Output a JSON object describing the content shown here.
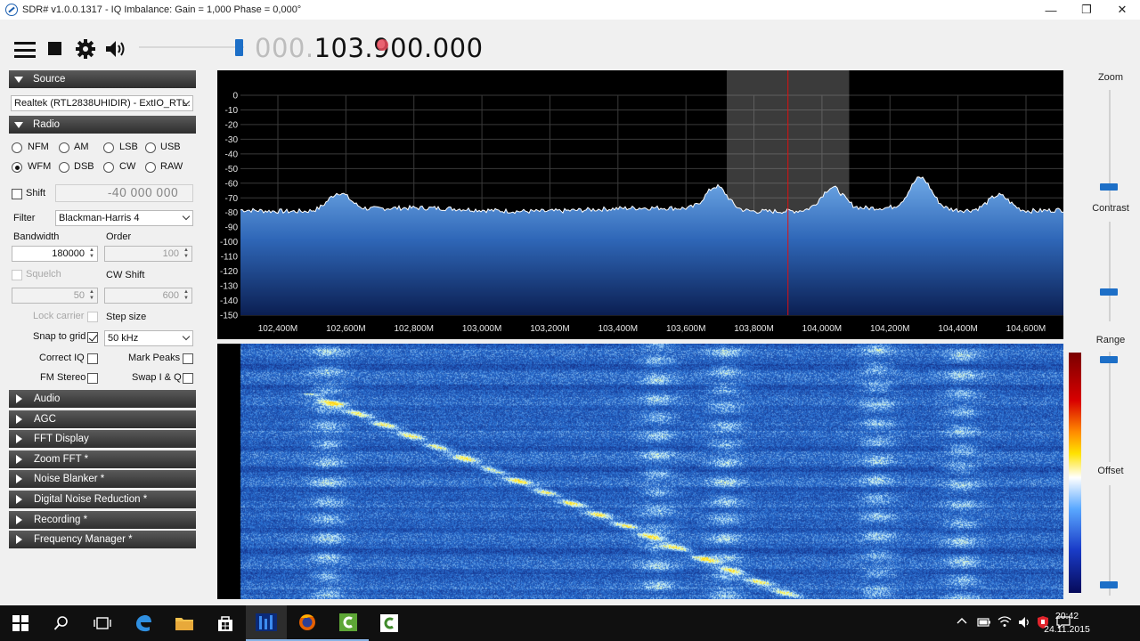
{
  "window": {
    "title": "SDR# v1.0.0.1317 - IQ Imbalance: Gain = 1,000 Phase = 0,000°",
    "minimize": "—",
    "maximize": "❐",
    "close": "✕"
  },
  "toolbar": {
    "frequency_dim": "000.",
    "frequency_lit": "103.900.000",
    "volume": 0.92
  },
  "source": {
    "header": "Source",
    "device": "Realtek (RTL2838UHIDIR) - ExtIO_RTL."
  },
  "radio": {
    "header": "Radio",
    "modes": [
      {
        "label": "NFM",
        "selected": false
      },
      {
        "label": "AM",
        "selected": false
      },
      {
        "label": "LSB",
        "selected": false
      },
      {
        "label": "USB",
        "selected": false
      },
      {
        "label": "WFM",
        "selected": true
      },
      {
        "label": "DSB",
        "selected": false
      },
      {
        "label": "CW",
        "selected": false
      },
      {
        "label": "RAW",
        "selected": false
      }
    ],
    "shift_label": "Shift",
    "shift_value": "-40 000 000",
    "filter_label": "Filter",
    "filter_value": "Blackman-Harris 4",
    "bandwidth_label": "Bandwidth",
    "bandwidth_value": "180000",
    "order_label": "Order",
    "order_value": "100",
    "squelch_label": "Squelch",
    "squelch_value": "50",
    "cwshift_label": "CW Shift",
    "cwshift_value": "600",
    "lock_carrier_label": "Lock carrier",
    "step_size_label": "Step size",
    "snap_label": "Snap to grid",
    "snap_value": "50 kHz",
    "correct_iq_label": "Correct IQ",
    "mark_peaks_label": "Mark Peaks",
    "fm_stereo_label": "FM Stereo",
    "swap_iq_label": "Swap I & Q"
  },
  "sections": [
    "Audio",
    "AGC",
    "FFT Display",
    "Zoom FFT *",
    "Noise Blanker *",
    "Digital Noise Reduction *",
    "Recording *",
    "Frequency Manager *"
  ],
  "spectrum": {
    "y_ticks": [
      "0",
      "-10",
      "-20",
      "-30",
      "-40",
      "-50",
      "-60",
      "-70",
      "-80",
      "-90",
      "-100",
      "-110",
      "-120",
      "-130",
      "-140",
      "-150"
    ],
    "x_ticks": [
      "102,400M",
      "102,600M",
      "102,800M",
      "103,000M",
      "103,200M",
      "103,400M",
      "103,600M",
      "103,800M",
      "104,000M",
      "104,200M",
      "104,400M",
      "104,600M"
    ],
    "x_range_mhz": [
      102.29,
      104.71
    ],
    "y_range_db": [
      -150,
      0
    ],
    "tuned_mhz": 103.9,
    "filter_bandwidth_khz": 180,
    "peaks": [
      {
        "mhz": 102.58,
        "db": -66
      },
      {
        "mhz": 103.69,
        "db": -62
      },
      {
        "mhz": 104.03,
        "db": -63
      },
      {
        "mhz": 104.29,
        "db": -57
      },
      {
        "mhz": 104.52,
        "db": -67
      }
    ],
    "noise_floor_db": -78
  },
  "right_panel": {
    "zoom_label": "Zoom",
    "contrast_label": "Contrast",
    "range_label": "Range",
    "offset_label": "Offset"
  },
  "taskbar": {
    "time": "20:42",
    "date": "24.11.2015"
  }
}
